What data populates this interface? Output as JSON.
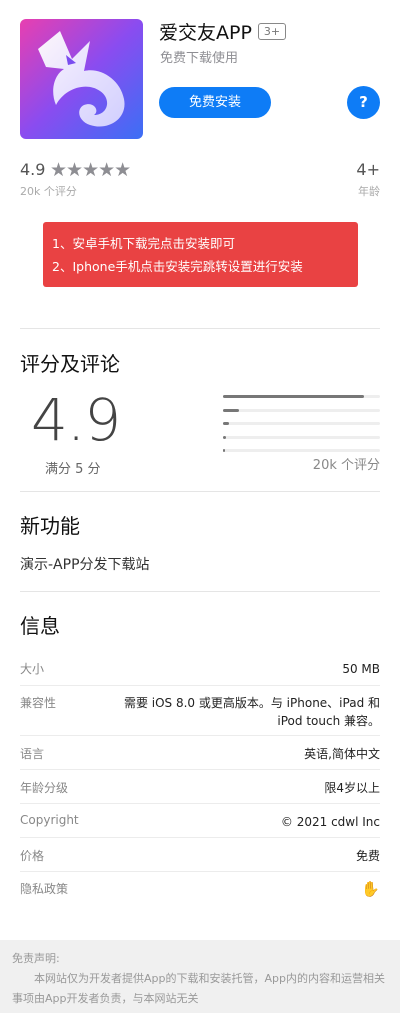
{
  "app": {
    "name": "爱交友APP",
    "age_tag": "3+",
    "subtitle": "免费下载使用",
    "install_label": "免费安装",
    "help_label": "?"
  },
  "rating": {
    "value": "4.9",
    "stars": "★★★★★",
    "count": "20k 个评分",
    "age_value": "4+",
    "age_label": "年龄"
  },
  "notice": {
    "line1": "1、安卓手机下载完点击安装即可",
    "line2": "2、Iphone手机点击安装完跳转设置进行安装"
  },
  "reviews": {
    "title": "评分及评论",
    "value": "4.9",
    "out_of": "满分 5 分",
    "count": "20k 个评分",
    "distribution": [
      0.9,
      0.1,
      0.04,
      0.02,
      0.01
    ]
  },
  "new_features": {
    "title": "新功能",
    "text": "演示-APP分发下载站"
  },
  "info": {
    "title": "信息",
    "rows": [
      {
        "key": "大小",
        "value": "50 MB"
      },
      {
        "key": "兼容性",
        "value_line1": "需要 iOS 8.0 或更高版本。与 iPhone、iPad 和",
        "value_line2": "iPod touch 兼容。"
      },
      {
        "key": "语言",
        "value": "英语,简体中文"
      },
      {
        "key": "年龄分级",
        "value": "限4岁以上"
      },
      {
        "key": "Copyright",
        "value": "© 2021 cdwl Inc"
      },
      {
        "key": "价格",
        "value": "免费"
      },
      {
        "key": "隐私政策",
        "value": "✋"
      }
    ]
  },
  "footer": {
    "heading": "免责声明:",
    "body": "本网站仅为开发者提供App的下载和安装托管，App内的内容和运营相关事项由App开发者负责，与本网站无关"
  },
  "colors": {
    "accent": "#0e7cf6",
    "notice_bg": "#e94243",
    "icon_gradient": [
      "#e83fb0",
      "#7a4cf0",
      "#3b6ff5"
    ]
  }
}
